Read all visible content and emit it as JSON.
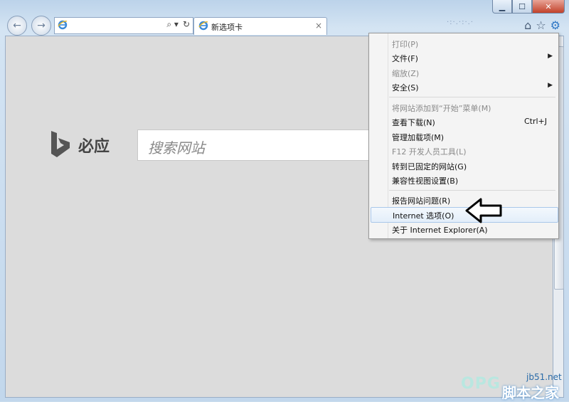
{
  "browser": {
    "tab_title": "新选项卡",
    "tab_close": "×",
    "address_controls": [
      "⌕ ▾",
      "↻"
    ],
    "blurred_text": "·:·.·:·.·",
    "window_buttons": {
      "minimize": "▁",
      "maximize": "☐",
      "close": "✕"
    }
  },
  "nav": {
    "back": "←",
    "forward": "→"
  },
  "toolbar_icons": {
    "home": "⌂",
    "favorites": "☆",
    "tools": "⚙"
  },
  "page": {
    "brand_name": "必应",
    "search_placeholder": "搜索网站"
  },
  "menu": {
    "items": [
      {
        "label": "打印(P)",
        "disabled": true
      },
      {
        "label": "文件(F)",
        "submenu": true
      },
      {
        "label": "缩放(Z)",
        "disabled": true
      },
      {
        "label": "安全(S)",
        "submenu": true
      },
      {
        "label": "将网站添加到“开始”菜单(M)",
        "disabled": true
      },
      {
        "label": "查看下载(N)",
        "shortcut": "Ctrl+J"
      },
      {
        "label": "管理加载项(M)"
      },
      {
        "label": "F12 开发人员工具(L)",
        "disabled": true
      },
      {
        "label": "转到已固定的网站(G)"
      },
      {
        "label": "兼容性视图设置(B)"
      },
      {
        "label": "报告网站问题(R)"
      },
      {
        "label": "Internet 选项(O)",
        "highlighted": true
      },
      {
        "label": "关于 Internet Explorer(A)"
      }
    ],
    "arrow_glyph": "▶"
  },
  "watermark": {
    "site": "jb51.net",
    "brand": "脚本之家",
    "opg": "OPG"
  },
  "colors": {
    "menu_highlight": "#e3eefa",
    "accent": "#2f78c6",
    "content_bg": "#dcdcdc"
  }
}
